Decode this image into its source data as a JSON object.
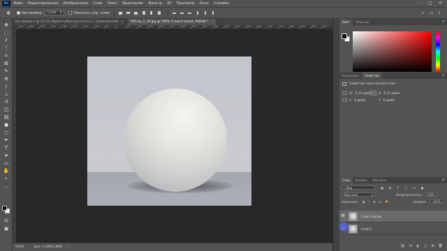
{
  "app": {
    "logo": "Ps"
  },
  "menu": [
    "Файл",
    "Редактирование",
    "Изображение",
    "Слои",
    "Текст",
    "Выделение",
    "Фильтр",
    "3D",
    "Просмотр",
    "Окно",
    "Справка"
  ],
  "window_controls": [
    "–",
    "□",
    "✕"
  ],
  "options": {
    "autoselect_label": "Автовыбор:",
    "autoselect_value": "Слой",
    "transform_label": "Показать упр. элем."
  },
  "tabs": [
    {
      "label": "Без имени-1 @ 33,3% (Яркость/Контрастность 1, Слой-маска/8)",
      "close": "×",
      "active": false
    },
    {
      "label": "700-nw_1_10.jpg @ 100% (Слой 0 копия, RGB/8) *",
      "close": "×",
      "active": true
    }
  ],
  "ruler": [
    "-450",
    "-400",
    "-350",
    "-300",
    "-250",
    "-200",
    "-150",
    "-100",
    "-50",
    "0",
    "50",
    "100",
    "150",
    "200",
    "250",
    "300",
    "350",
    "400",
    "450",
    "500",
    "550",
    "600",
    "650",
    "700",
    "750",
    "800",
    "850",
    "900",
    "950"
  ],
  "status": {
    "zoom": "100%",
    "doc": "Док: 1,40М/2,80М",
    "arrow": "›"
  },
  "color_panel": {
    "tabs": [
      "Цвет",
      "Образцы"
    ],
    "fg": "#111111",
    "bg": "#ffffff"
  },
  "properties_panel": {
    "tabs": [
      "Коррекция",
      "Свойства"
    ],
    "title": "Свойства пиксельного слоя",
    "w_label": "Ш:",
    "w_value": "9,72 дюйм",
    "h_label": "В:",
    "h_value": "9,72 дюйм",
    "x_label": "X:",
    "x_value": "0 дюйм",
    "y_label": "Y:",
    "y_value": "0 дюйм",
    "link": "GO"
  },
  "layers_panel": {
    "tabs": [
      "Слои",
      "Каналы",
      "Контуры"
    ],
    "filter_value": "Вид",
    "blend_mode": "Обычные",
    "opacity_label": "Непрозрачность:",
    "opacity_value": "100%",
    "lock_label": "Закрепить:",
    "fill_label": "Заливка:",
    "fill_value": "100%",
    "layers": [
      {
        "name": "Слой 0 копия",
        "visible": true,
        "active": true
      },
      {
        "name": "Слой 0",
        "visible": true,
        "active": false
      }
    ],
    "bottom_icons": [
      "fx",
      "◐",
      "▢",
      "⊞",
      "🗑"
    ]
  }
}
